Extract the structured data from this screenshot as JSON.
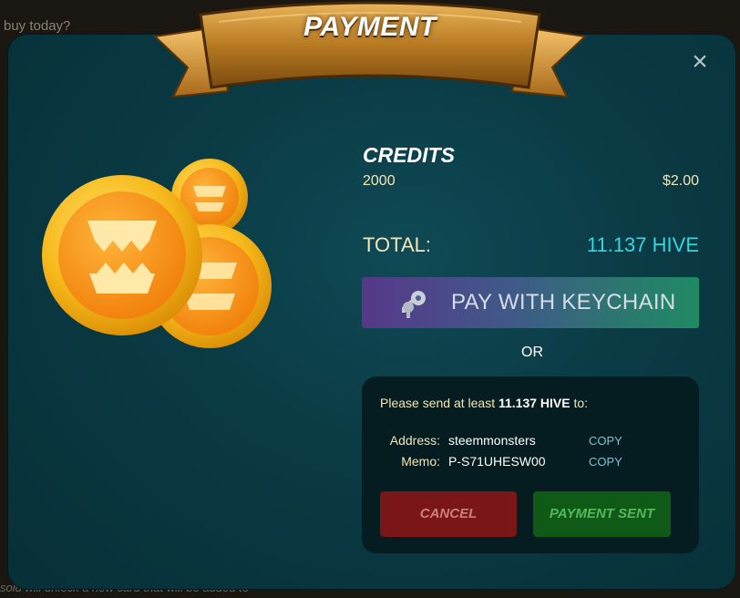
{
  "background": {
    "fragment_top": "buy today?",
    "fragment_bottom": "sold will unlock a new card that will be added to"
  },
  "modal": {
    "title": "PAYMENT",
    "close_glyph": "×",
    "product": {
      "name": "CREDITS",
      "quantity": "2000",
      "price": "$2.00"
    },
    "total": {
      "label": "TOTAL:",
      "value": "11.137 HIVE"
    },
    "keychain_button": {
      "label": "PAY WITH KEYCHAIN",
      "icon": "keys-icon"
    },
    "or_label": "OR",
    "manual": {
      "send_prefix": "Please send at least ",
      "send_amount": "11.137 HIVE",
      "send_suffix": " to:",
      "address_label": "Address:",
      "address_value": "steemmonsters",
      "memo_label": "Memo:",
      "memo_value": "P-S71UHESW00",
      "copy_label": "COPY"
    },
    "cancel_label": "CANCEL",
    "payment_sent_label": "PAYMENT SENT"
  },
  "colors": {
    "accent_total": "#35d6de",
    "cancel": "#7a1518",
    "payment_sent": "#0e5a16"
  }
}
